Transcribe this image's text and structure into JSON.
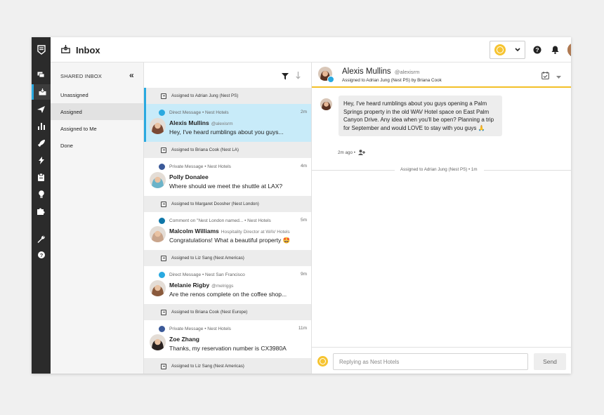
{
  "topbar": {
    "title": "Inbox"
  },
  "folders": {
    "header": "SHARED INBOX",
    "items": [
      {
        "label": "Unassigned",
        "active": false
      },
      {
        "label": "Assigned",
        "active": true
      },
      {
        "label": "Assigned to Me",
        "active": false
      },
      {
        "label": "Done",
        "active": false
      }
    ]
  },
  "list": {
    "rows": [
      {
        "kind": "assign",
        "text": "Assigned to Adrian Jung (Nest PS)",
        "active": true
      },
      {
        "kind": "conv",
        "source": "twitter",
        "meta": "Direct Message  •  Nest Hotels",
        "time": "2m",
        "name": "Alexis Mullins",
        "sub": "@alexisrm",
        "msg": "Hey, I've heard rumblings about you guys...",
        "active": true,
        "avatar_color": "#7a4a35"
      },
      {
        "kind": "assign",
        "text": "Assigned to Briana Cook (Nest LA)"
      },
      {
        "kind": "conv",
        "source": "facebook",
        "meta": "Private Message  •  Nest Hotels",
        "time": "4m",
        "name": "Polly Donalee",
        "sub": "",
        "msg": "Where should we meet the shuttle at LAX?",
        "avatar_color": "#6bb3c9"
      },
      {
        "kind": "assign",
        "text": "Assigned to Margaret Doosher (Nest London)"
      },
      {
        "kind": "conv",
        "source": "linkedin",
        "meta": "Comment on \"Nest London named...  •  Nest Hotels",
        "time": "5m",
        "name": "Malcolm Williams",
        "sub": "Hospitality Director at WAV Hotels",
        "msg": "Congratulations! What a beautiful property 🤩",
        "avatar_color": "#c9a58c"
      },
      {
        "kind": "assign",
        "text": "Assigned to Liz Sang (Nest Americas)"
      },
      {
        "kind": "conv",
        "source": "twitter",
        "meta": "Direct Message  •  Nest San Francisco",
        "time": "9m",
        "name": "Melanie Rigby",
        "sub": "@melriggs",
        "msg": "Are the renos complete on the coffee shop...",
        "avatar_color": "#8a5a3c"
      },
      {
        "kind": "assign",
        "text": "Assigned to Briana Cook (Nest Europe)"
      },
      {
        "kind": "conv",
        "source": "facebook",
        "meta": "Private Message  •  Nest Hotels",
        "time": "11m",
        "name": "Zoe Zhang",
        "sub": "",
        "msg": "Thanks, my reservation number is CX3980A",
        "avatar_color": "#2a2220"
      },
      {
        "kind": "assign",
        "text": "Assigned to Liz Sang (Nest Americas)"
      }
    ]
  },
  "detail": {
    "name": "Alexis Mullins",
    "handle": "@alexisrm",
    "assigned": "Assigned to Adrian Jung (Nest PS) by Briana Cook",
    "message": "Hey, I've heard rumblings about you guys opening a Palm Springs property in the old WAV Hotel space on East Palm Canyon Drive. Any idea when you'll be open? Planning a trip for September and would LOVE to stay with you guys 🙏",
    "timestamp": "2m ago  •",
    "event": "Assigned to Adrian Jung (Nest PS) • 1m"
  },
  "reply": {
    "placeholder": "Replying as Nest Hotels",
    "send_label": "Send"
  },
  "colors": {
    "twitter": "#29a9e0",
    "facebook": "#3b5998",
    "linkedin": "#0e76a8",
    "accent": "#29a9e0",
    "brand_yellow": "#f6c431"
  },
  "icons": {
    "rail": [
      "inbox-icon",
      "send-icon",
      "bar-chart-icon",
      "rocket-icon",
      "lightning-icon",
      "clipboard-icon",
      "lightbulb-icon",
      "puzzle-icon",
      "wrench-icon",
      "help-icon"
    ],
    "topbar": [
      "inbox-tray-icon",
      "help-icon",
      "bell-icon"
    ],
    "list_header": [
      "filter-icon",
      "sort-down-icon"
    ],
    "detail_header": [
      "task-icon",
      "caret-down-icon"
    ]
  }
}
